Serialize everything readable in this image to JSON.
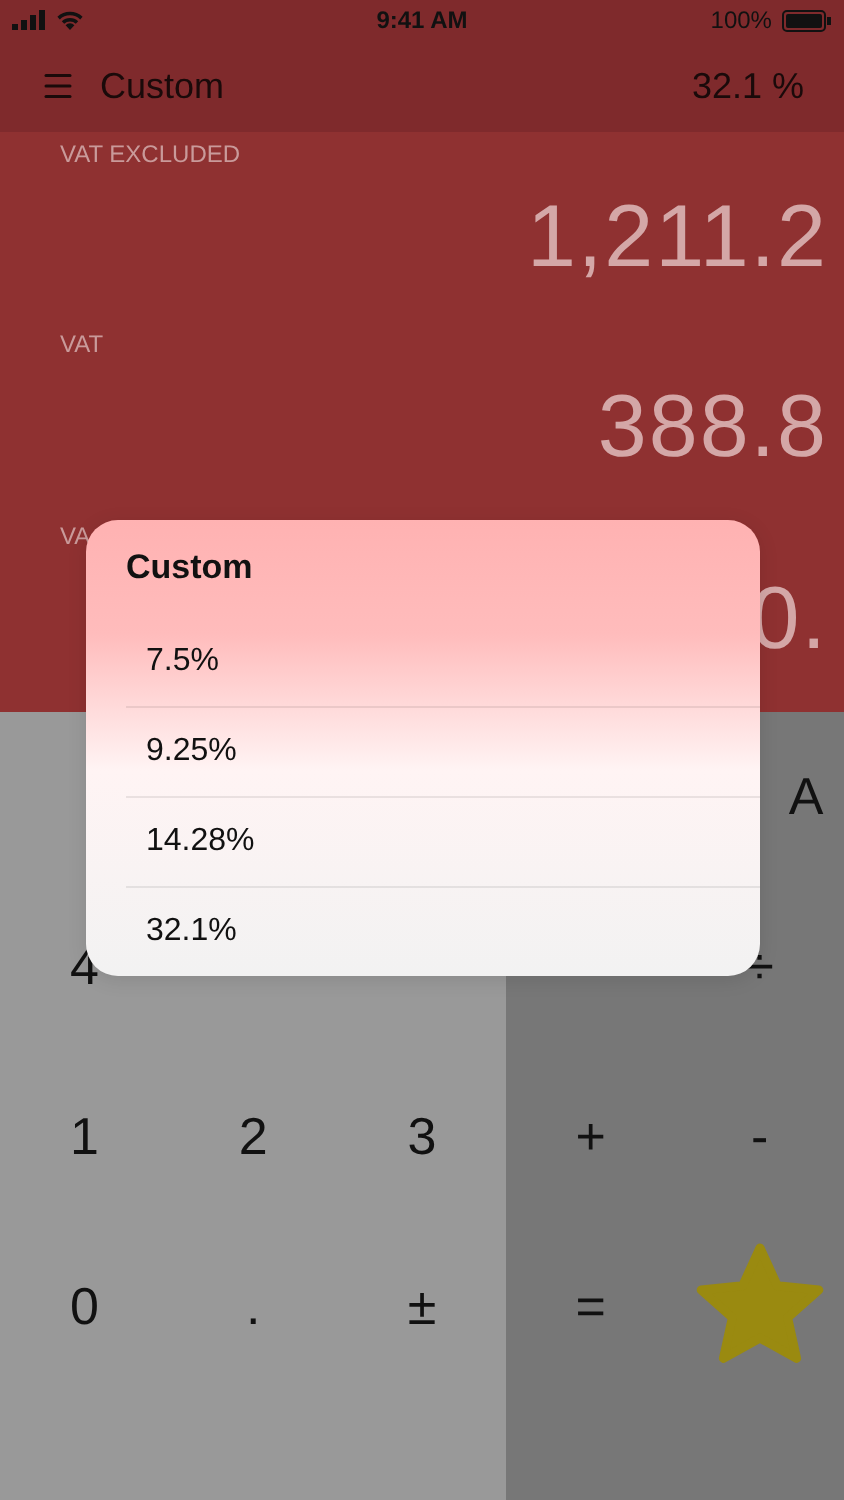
{
  "status_bar": {
    "time": "9:41 AM",
    "battery": "100%"
  },
  "nav_bar": {
    "title": "Custom",
    "rate": "32.1 %"
  },
  "display": [
    {
      "label": "VAT EXCLUDED",
      "value": "1,211.2"
    },
    {
      "label": "VAT",
      "value": "388.8"
    },
    {
      "label": "VA",
      "value": "0."
    }
  ],
  "keypad": [
    [
      {
        "kind": "blank"
      },
      {
        "kind": "blank"
      },
      {
        "kind": "blank"
      },
      {
        "kind": "blank"
      },
      {
        "kind": "edge",
        "label": "A"
      }
    ],
    [
      {
        "kind": "key",
        "label": "4"
      },
      {
        "kind": "blank"
      },
      {
        "kind": "blank"
      },
      {
        "kind": "blank"
      },
      {
        "kind": "key",
        "label": "÷"
      }
    ],
    [
      {
        "kind": "key",
        "label": "1"
      },
      {
        "kind": "key",
        "label": "2"
      },
      {
        "kind": "key",
        "label": "3"
      },
      {
        "kind": "key",
        "label": "+"
      },
      {
        "kind": "key",
        "label": "-"
      }
    ],
    [
      {
        "kind": "key",
        "label": "0"
      },
      {
        "kind": "key",
        "label": "."
      },
      {
        "kind": "key",
        "label": "±"
      },
      {
        "kind": "key",
        "label": "="
      },
      {
        "kind": "star"
      }
    ]
  ],
  "popup": {
    "title": "Custom",
    "options": [
      {
        "label": "7.5%"
      },
      {
        "label": "9.25%"
      },
      {
        "label": "14.28%"
      },
      {
        "label": "32.1%"
      }
    ]
  }
}
